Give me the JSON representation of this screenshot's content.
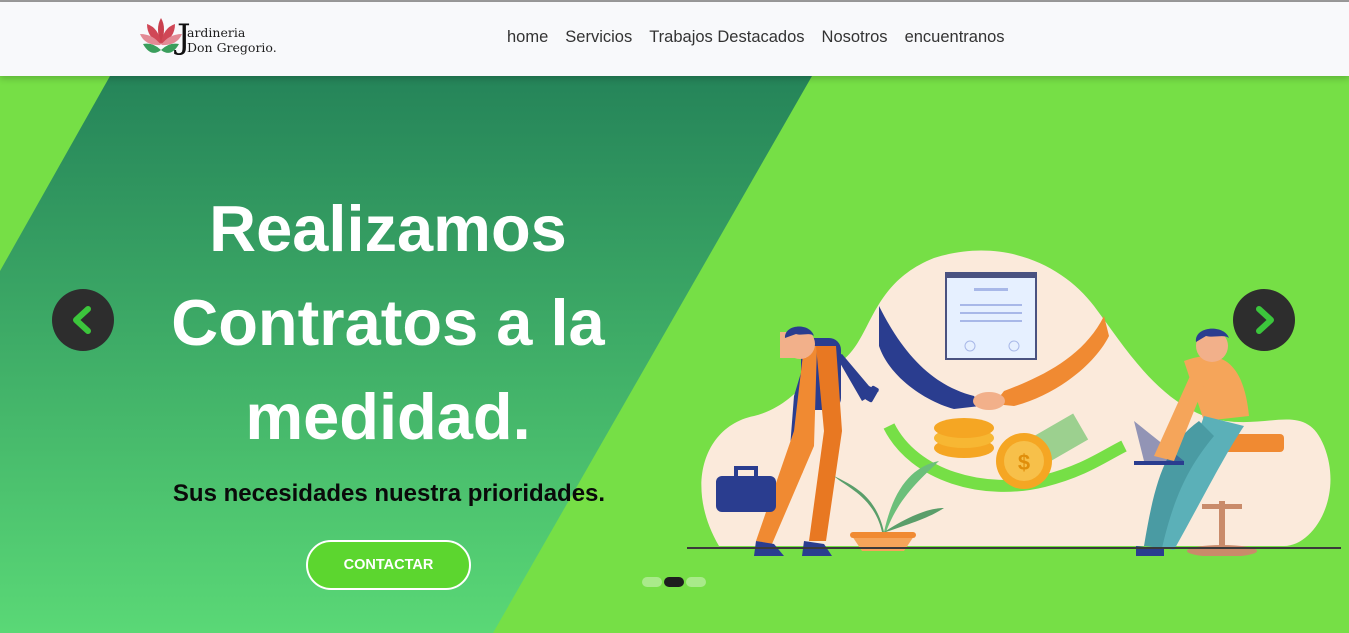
{
  "brand": {
    "line1": "ardineria",
    "line2": "Don Gregorio.",
    "initial": "J",
    "logo_icon": "lotus-flower-icon"
  },
  "nav": {
    "links": [
      "home",
      "Servicios",
      "Trabajos Destacados",
      "Nosotros",
      "encuentranos"
    ]
  },
  "hero": {
    "headline": "Realizamos Contratos a la medidad.",
    "subheadline": "Sus necesidades nuestra prioridades.",
    "cta_label": "CONTACTAR",
    "prev_icon": "chevron-left-icon",
    "next_icon": "chevron-right-icon",
    "slide_count": 3,
    "active_slide": 2,
    "illustration": "business-handshake-illustration"
  },
  "colors": {
    "hero_green": "#76df46",
    "dark_band_top": "#258459",
    "dark_band_bottom": "#5ad876",
    "cta_fill": "#5cd62f",
    "arrow_bg": "#2d2d2d",
    "arrow_chevron": "#3cc63c",
    "navbar_bg": "#f8f9fb"
  }
}
